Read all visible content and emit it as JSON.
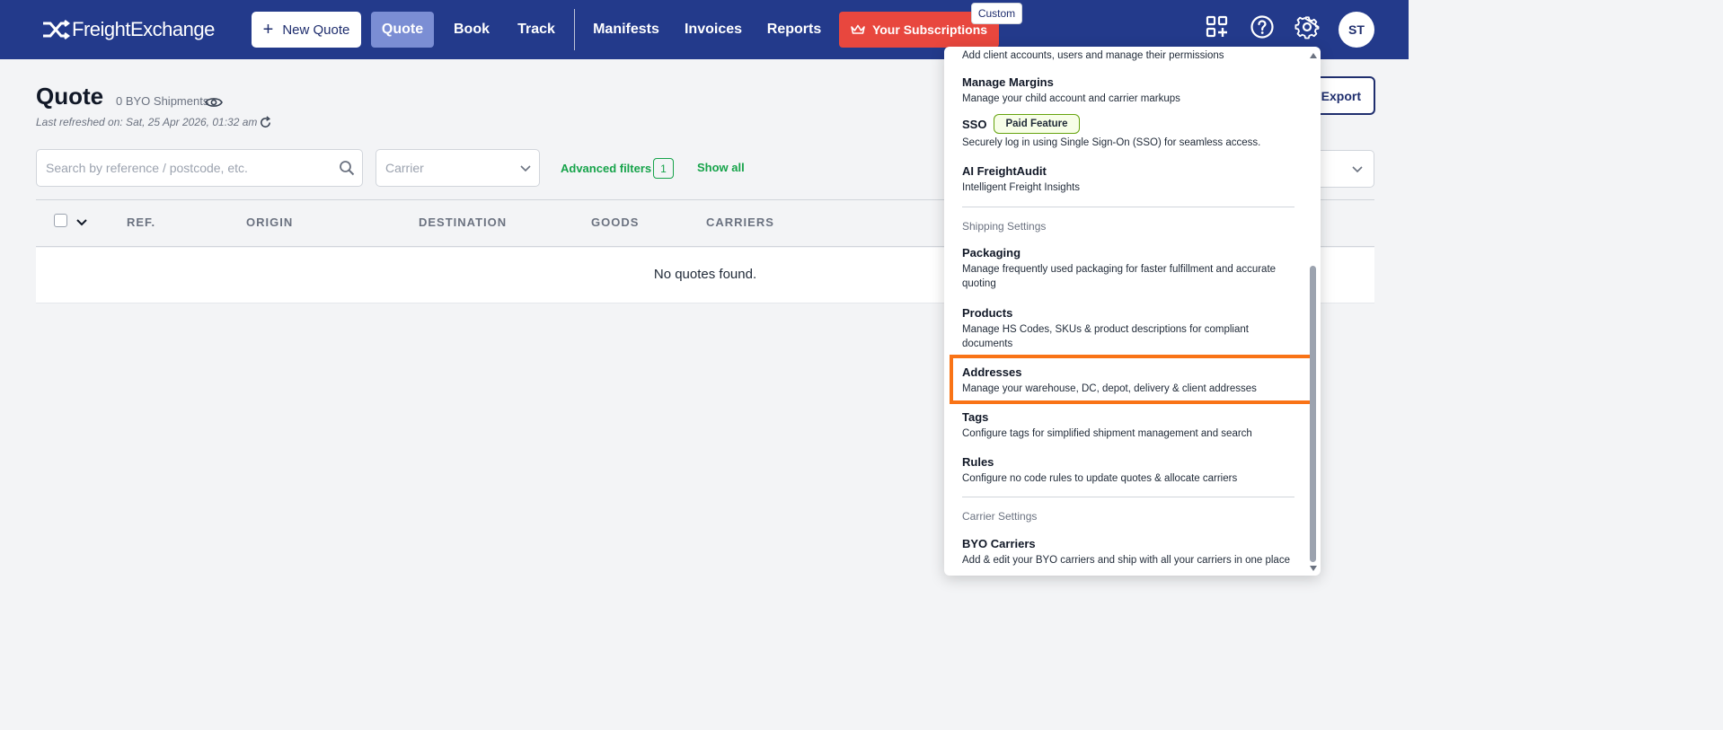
{
  "nav": {
    "logo_text": "FreightExchange",
    "new_quote_label": "New Quote",
    "items": [
      {
        "label": "Quote",
        "active": true
      },
      {
        "label": "Book"
      },
      {
        "label": "Track"
      },
      {
        "label": "Manifests"
      },
      {
        "label": "Invoices"
      },
      {
        "label": "Reports"
      }
    ],
    "subscriptions_label": "Your Subscriptions",
    "custom_badge": "Custom",
    "avatar_initials": "ST",
    "icons": [
      "crown-icon",
      "grid-plus-icon",
      "help-icon",
      "gear-icon"
    ]
  },
  "page": {
    "title": "Quote",
    "byo_count": "0 BYO Shipments",
    "last_refreshed": "Last refreshed on: Sat, 25 Apr 2026, 01:32 am",
    "export_label": "Export"
  },
  "filters": {
    "search_placeholder": "Search by reference / postcode, etc.",
    "carrier_placeholder": "Carrier",
    "advanced_filters_label": "Advanced filters",
    "advanced_filters_count": "1",
    "show_all_label": "Show all"
  },
  "table": {
    "columns": [
      "REF.",
      "ORIGIN",
      "DESTINATION",
      "GOODS",
      "CARRIERS"
    ],
    "empty_message": "No quotes found."
  },
  "dropdown": {
    "top_partial_desc": "Add client accounts, users and manage their permissions",
    "account_items": [
      {
        "title": "Manage Margins",
        "desc": "Manage your child account and carrier markups"
      },
      {
        "title": "SSO",
        "badge": "Paid Feature",
        "desc": "Securely log in using Single Sign-On (SSO) for seamless access."
      },
      {
        "title": "AI FreightAudit",
        "desc": "Intelligent Freight Insights"
      }
    ],
    "shipping_section": "Shipping Settings",
    "shipping_items": [
      {
        "title": "Packaging",
        "desc": "Manage frequently used packaging for faster fulfillment and accurate quoting"
      },
      {
        "title": "Products",
        "desc": "Manage HS Codes, SKUs & product descriptions for compliant documents"
      },
      {
        "title": "Addresses",
        "desc": "Manage your warehouse, DC, depot, delivery & client addresses",
        "highlighted": true
      },
      {
        "title": "Tags",
        "desc": "Configure tags for simplified shipment management and search"
      },
      {
        "title": "Rules",
        "desc": "Configure no code rules to update quotes & allocate carriers"
      }
    ],
    "carrier_section": "Carrier Settings",
    "carrier_items": [
      {
        "title": "BYO Carriers",
        "desc": "Add & edit your BYO carriers and ship with all your carriers in one place"
      }
    ]
  },
  "colors": {
    "navbar": "#233a8b",
    "accent_red": "#e8473e",
    "accent_green": "#16a34a",
    "highlight_orange": "#f97316"
  }
}
